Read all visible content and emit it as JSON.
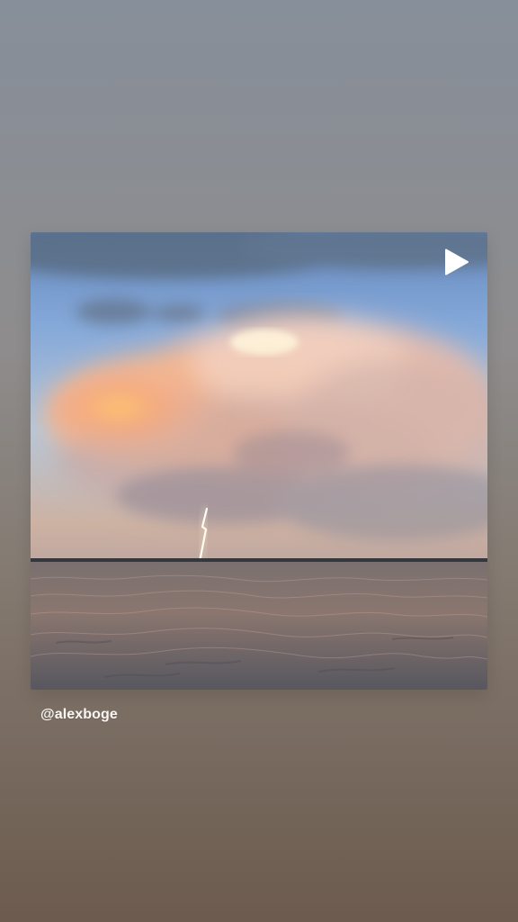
{
  "story": {
    "credit_text": "@alexboge"
  },
  "icons": {
    "play": "play-icon"
  }
}
